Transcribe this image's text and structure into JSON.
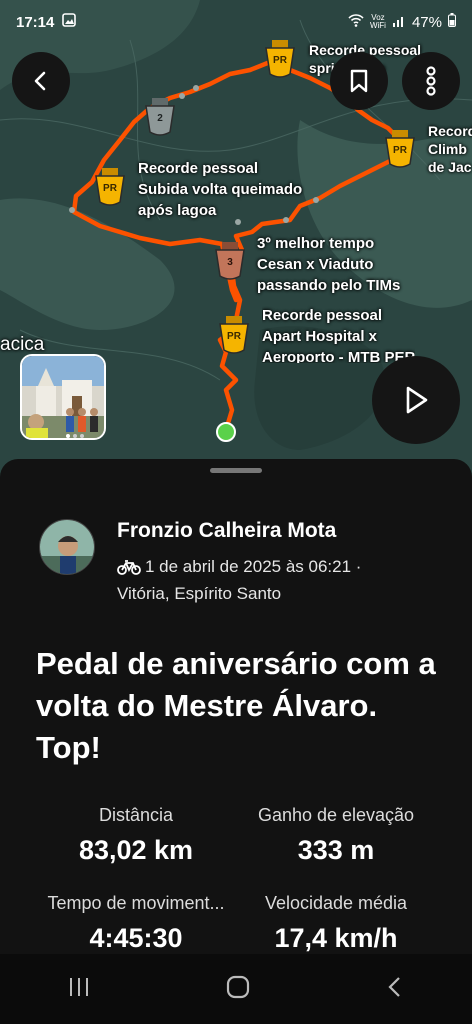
{
  "status_bar": {
    "time": "17:14",
    "voz": "Voz",
    "wifi": "WiFi",
    "battery": "47%"
  },
  "map": {
    "place_label": "acica",
    "segments": [
      {
        "badge": "PR",
        "lines": [
          "Recorde pessoal",
          "sprint Lago"
        ]
      },
      {
        "badge": "PR",
        "lines": [
          "Recorde",
          "Climb",
          "de Jac"
        ]
      },
      {
        "badge": "PR",
        "lines": [
          "Recorde pessoal",
          "Subida volta queimado",
          "após lagoa"
        ]
      },
      {
        "badge": "3",
        "lines": [
          "3º melhor tempo",
          "Cesan x Viaduto",
          "passando pelo TIMs"
        ]
      },
      {
        "badge": "PR",
        "lines": [
          "Recorde pessoal",
          "Apart Hospital x",
          "Aeroporto - MTB PER"
        ]
      }
    ],
    "rank_badge_2": "2"
  },
  "activity": {
    "athlete": "Fronzio Calheira Mota",
    "date": "1 de abril de 2025 às 06:21 ·",
    "location": "Vitória, Espírito Santo",
    "title": "Pedal de aniversário com a volta do Mestre Álvaro. Top!"
  },
  "stats": [
    {
      "label": "Distância",
      "value": "83,02 km"
    },
    {
      "label": "Ganho de elevação",
      "value": "333 m"
    },
    {
      "label": "Tempo de moviment...",
      "value": "4:45:30"
    },
    {
      "label": "Velocidade média",
      "value": "17,4 km/h"
    }
  ],
  "colors": {
    "route": "#fc5200",
    "pr_badge": "#f5b400",
    "sheet": "#121212"
  }
}
